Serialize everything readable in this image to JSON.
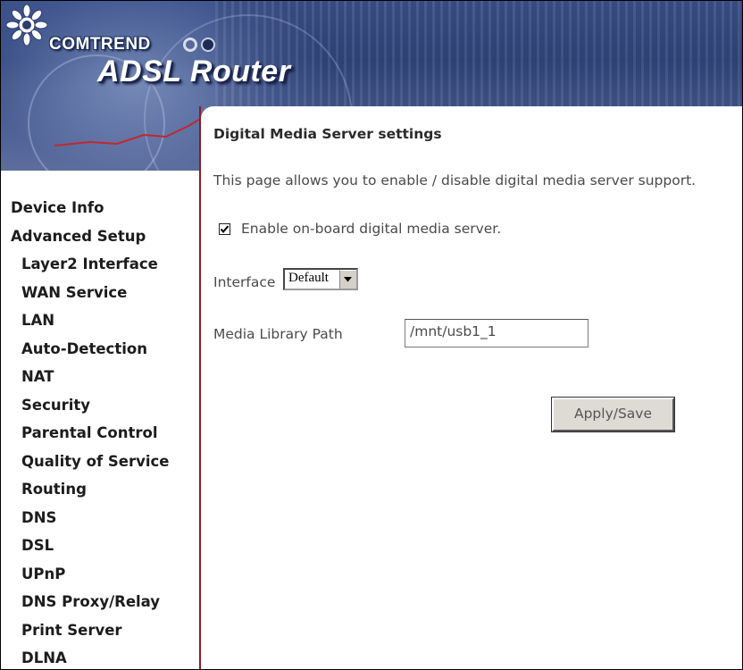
{
  "header": {
    "brand": "COMTREND",
    "product": "ADSL Router",
    "colors": {
      "banner": "#3a4f86",
      "accent_line": "#8b1a24",
      "text_light": "#ffffff"
    }
  },
  "sidebar": {
    "items": [
      {
        "label": "Device Info",
        "level": "top"
      },
      {
        "label": "Advanced Setup",
        "level": "top"
      },
      {
        "label": "Layer2 Interface",
        "level": "sub"
      },
      {
        "label": "WAN Service",
        "level": "sub"
      },
      {
        "label": "LAN",
        "level": "sub"
      },
      {
        "label": "Auto-Detection",
        "level": "sub"
      },
      {
        "label": "NAT",
        "level": "sub"
      },
      {
        "label": "Security",
        "level": "sub"
      },
      {
        "label": "Parental Control",
        "level": "sub"
      },
      {
        "label": "Quality of Service",
        "level": "sub"
      },
      {
        "label": "Routing",
        "level": "sub"
      },
      {
        "label": "DNS",
        "level": "sub"
      },
      {
        "label": "DSL",
        "level": "sub"
      },
      {
        "label": "UPnP",
        "level": "sub"
      },
      {
        "label": "DNS Proxy/Relay",
        "level": "sub"
      },
      {
        "label": "Print Server",
        "level": "sub"
      },
      {
        "label": "DLNA",
        "level": "sub"
      }
    ]
  },
  "main": {
    "title": "Digital Media Server settings",
    "description": "This page allows you to enable / disable digital media server support.",
    "enable": {
      "label": "Enable on-board digital media server.",
      "checked": true
    },
    "interface": {
      "label": "Interface",
      "selected": "Default"
    },
    "media_path": {
      "label": "Media Library Path",
      "value": "/mnt/usb1_1"
    },
    "apply_label": "Apply/Save"
  }
}
